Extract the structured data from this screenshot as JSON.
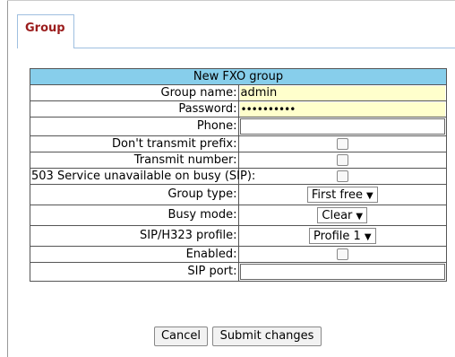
{
  "tab": {
    "label": "Group"
  },
  "form": {
    "title": "New FXO group",
    "rows": {
      "group_name": {
        "label": "Group name:",
        "value": "admin"
      },
      "password": {
        "label": "Password:",
        "value": "••••••••••"
      },
      "phone": {
        "label": "Phone:",
        "value": ""
      },
      "dont_transmit_prefix": {
        "label": "Don't transmit prefix:",
        "checked": false
      },
      "transmit_number": {
        "label": "Transmit number:",
        "checked": false
      },
      "service_unavailable": {
        "label": "503 Service unavailable on busy (SIP):",
        "checked": false
      },
      "group_type": {
        "label": "Group type:",
        "value": "First free"
      },
      "busy_mode": {
        "label": "Busy mode:",
        "value": "Clear"
      },
      "sip_profile": {
        "label": "SIP/H323 profile:",
        "value": "Profile 1"
      },
      "enabled": {
        "label": "Enabled:",
        "checked": false
      },
      "sip_port": {
        "label": "SIP port:",
        "value": ""
      }
    }
  },
  "buttons": {
    "cancel": "Cancel",
    "submit": "Submit changes"
  },
  "colors": {
    "header_bg": "#87ceeb",
    "input_highlight": "#ffffcc",
    "tab_text": "#9b1d1d"
  }
}
